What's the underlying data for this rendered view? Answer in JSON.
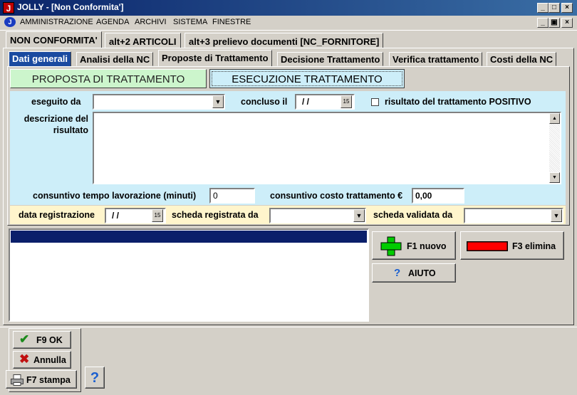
{
  "window": {
    "title": "JOLLY - [Non Conformita']",
    "app_icon": "J",
    "controls": [
      "_",
      "□",
      "×"
    ],
    "child_controls": [
      "_",
      "▣",
      "×"
    ]
  },
  "menu": [
    "AMMINISTRAZIONE",
    "AGENDA",
    "ARCHIVI",
    "SISTEMA",
    "FINESTRE"
  ],
  "main_tabs": [
    "NON CONFORMITA'",
    "alt+2  ARTICOLI",
    "alt+3  prelievo documenti [NC_FORNITORE]"
  ],
  "sub_tabs": [
    "Dati generali",
    "Analisi della NC",
    "Proposte di Trattamento",
    "Decisione Trattamento",
    "Verifica trattamento",
    "Costi della NC"
  ],
  "section_tabs": {
    "proposta": "PROPOSTA DI TRATTAMENTO",
    "esecuzione": "ESECUZIONE TRATTAMENTO"
  },
  "form": {
    "eseguito_da_label": "eseguito da",
    "eseguito_da_value": "",
    "concluso_il_label": "concluso il",
    "concluso_il_value": "/ /",
    "risultato_positivo_label": "risultato del trattamento POSITIVO",
    "descrizione_label_1": "descrizione del",
    "descrizione_label_2": "risultato",
    "descrizione_value": "",
    "tempo_label": "consuntivo tempo lavorazione (minuti)",
    "tempo_value": "0",
    "costo_label": "consuntivo costo trattamento €",
    "costo_value": "0,00",
    "data_registrazione_label": "data registrazione",
    "data_registrazione_value": "/ /",
    "scheda_registrata_label": "scheda registrata da",
    "scheda_validata_label": "scheda validata da",
    "calendar_glyph": "15"
  },
  "buttons": {
    "nuovo": "F1 nuovo",
    "elimina": "F3 elimina",
    "aiuto": "AIUTO",
    "ok": "F9 OK",
    "annulla": "Annulla",
    "stampa": "F7 stampa",
    "help": "?",
    "aiuto_icon": "?"
  },
  "colors": {
    "title_bar": "#0a246a",
    "form_bg": "#cdeef9",
    "yellow_row": "#fff5cc",
    "proposta_tab": "#ccf5cc",
    "esecuzione_tab": "#cdeef9",
    "list_header": "#0a1f6a",
    "plus_icon": "#00cc00",
    "elimina_icon": "#ff0000"
  }
}
